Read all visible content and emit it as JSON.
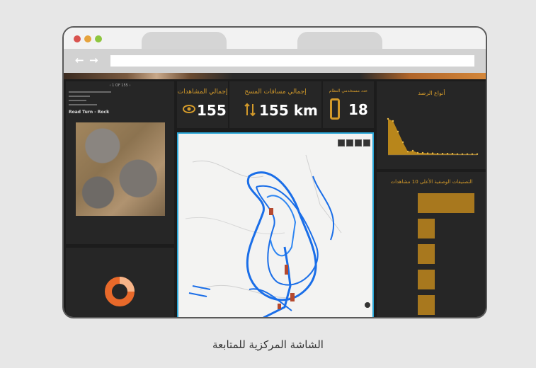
{
  "browser": {
    "dots": [
      "#d9534f",
      "#e6a33d",
      "#8ec63f"
    ],
    "back_glyph": "←",
    "forward_glyph": "→"
  },
  "dashboard": {
    "kpis": [
      {
        "label": "إجمالي المشاهدات",
        "value": "155",
        "icon": "eye-icon"
      },
      {
        "label": "إجمالي مسافات المسح",
        "value": "155 km",
        "icon": "route-icon"
      },
      {
        "label": "عدد مستخدمي النظام",
        "value": "18",
        "icon": "phone-icon"
      }
    ],
    "left_panel": {
      "pager": "‹ 1 OF 155 ›",
      "heading": "Road Turn - Rock"
    },
    "right_top": {
      "title": "أنواع الرصد"
    },
    "right_bottom": {
      "title": "التصنيفات الوصفية الأعلى 10 مشاهدات"
    },
    "donut": {
      "color": "#e8692a",
      "value": 0.75
    }
  },
  "chart_data": [
    {
      "type": "area",
      "title": "أنواع الرصد",
      "values": [
        85,
        80,
        55,
        30,
        8,
        10,
        5,
        5,
        4,
        4,
        3,
        3,
        3,
        3,
        2,
        2,
        2,
        2,
        2
      ],
      "color": "#b8861b"
    },
    {
      "type": "bar",
      "title": "التصنيفات الوصفية الأعلى 10 مشاهدات",
      "values": [
        100,
        30,
        30,
        30,
        30
      ],
      "color": "#a8781e"
    }
  ],
  "caption": "الشاشة المركزية للمتابعة"
}
